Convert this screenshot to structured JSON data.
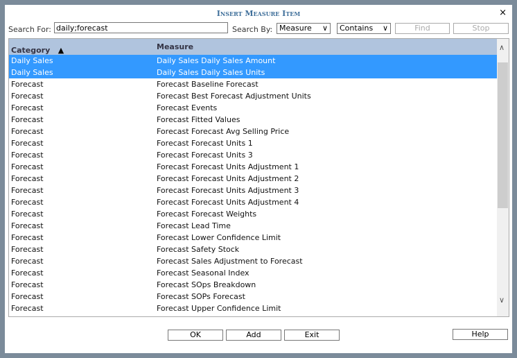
{
  "title": "Insert Measure Item",
  "close_icon": "×",
  "search": {
    "label": "Search For:",
    "value": "daily;forecast",
    "by_label": "Search By:",
    "by_value": "Measure",
    "match_value": "Contains",
    "find": "Find",
    "stop": "Stop"
  },
  "grid": {
    "headers": {
      "category": "Category",
      "measure": "Measure",
      "sort": "▲"
    },
    "rows": [
      {
        "c": "Daily Sales",
        "m": "Daily Sales Daily Sales Amount",
        "sel": true
      },
      {
        "c": "Daily Sales",
        "m": "Daily Sales Daily Sales Units",
        "sel": true
      },
      {
        "c": "Forecast",
        "m": "Forecast Baseline Forecast"
      },
      {
        "c": "Forecast",
        "m": "Forecast Best Forecast Adjustment Units"
      },
      {
        "c": "Forecast",
        "m": "Forecast Events"
      },
      {
        "c": "Forecast",
        "m": "Forecast Fitted Values"
      },
      {
        "c": "Forecast",
        "m": "Forecast Forecast Avg Selling Price"
      },
      {
        "c": "Forecast",
        "m": "Forecast Forecast Units 1"
      },
      {
        "c": "Forecast",
        "m": "Forecast Forecast Units 3"
      },
      {
        "c": "Forecast",
        "m": "Forecast Forecast Units Adjustment 1"
      },
      {
        "c": "Forecast",
        "m": "Forecast Forecast Units Adjustment 2"
      },
      {
        "c": "Forecast",
        "m": "Forecast Forecast Units Adjustment 3"
      },
      {
        "c": "Forecast",
        "m": "Forecast Forecast Units Adjustment 4"
      },
      {
        "c": "Forecast",
        "m": "Forecast Forecast Weights"
      },
      {
        "c": "Forecast",
        "m": "Forecast Lead Time"
      },
      {
        "c": "Forecast",
        "m": "Forecast Lower Confidence Limit"
      },
      {
        "c": "Forecast",
        "m": "Forecast Safety Stock"
      },
      {
        "c": "Forecast",
        "m": "Forecast Sales Adjustment to Forecast"
      },
      {
        "c": "Forecast",
        "m": "Forecast Seasonal Index"
      },
      {
        "c": "Forecast",
        "m": "Forecast SOps Breakdown"
      },
      {
        "c": "Forecast",
        "m": "Forecast SOPs Forecast"
      },
      {
        "c": "Forecast",
        "m": "Forecast Upper Confidence Limit"
      }
    ]
  },
  "buttons": {
    "ok": "OK",
    "add": "Add",
    "exit": "Exit",
    "help": "Help"
  },
  "colors": {
    "selected": "#3399ff",
    "header": "#b0c4de",
    "title": "#3f6f9a"
  }
}
